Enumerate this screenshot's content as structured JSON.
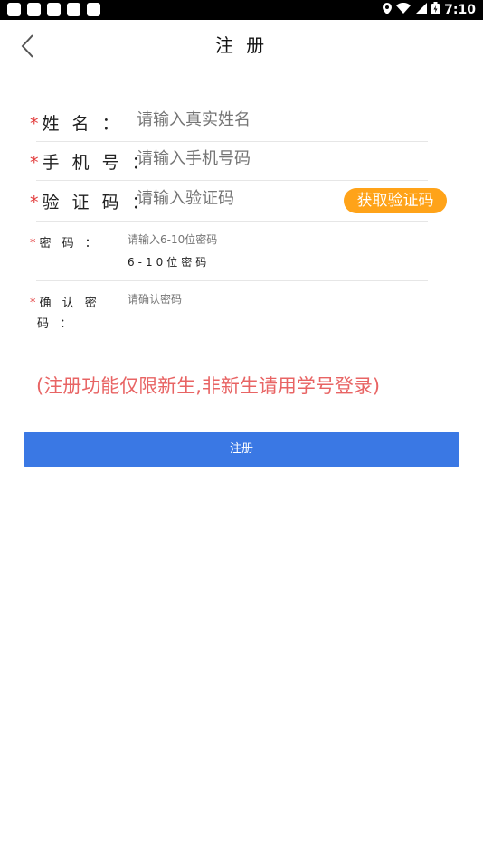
{
  "status_bar": {
    "time": "7:10",
    "icons": [
      "location-icon",
      "wifi-icon",
      "signal-icon",
      "battery-icon"
    ]
  },
  "header": {
    "title": "注 册"
  },
  "form": {
    "required_mark": "*",
    "name": {
      "label": "姓 名 ：",
      "placeholder": "请输入真实姓名"
    },
    "phone": {
      "label": "手 机 号 ：",
      "placeholder": "请输入手机号码"
    },
    "code": {
      "label": "验 证 码 ：",
      "placeholder": "请输入验证码",
      "button": "获取验证码"
    },
    "password": {
      "label": "密 码 ：",
      "placeholder": "请输入6-10位密码",
      "hint": "6-10位密码"
    },
    "confirm": {
      "label_line1": "确 认 密",
      "label_line2": "码 ：",
      "placeholder": "请确认密码"
    }
  },
  "notice": "(注册功能仅限新生,非新生请用学号登录)",
  "submit_label": "注册",
  "colors": {
    "accent_blue": "#3a78e4",
    "orange": "#ffa319",
    "notice_red": "#e86464",
    "required_red": "#e23b3b"
  }
}
